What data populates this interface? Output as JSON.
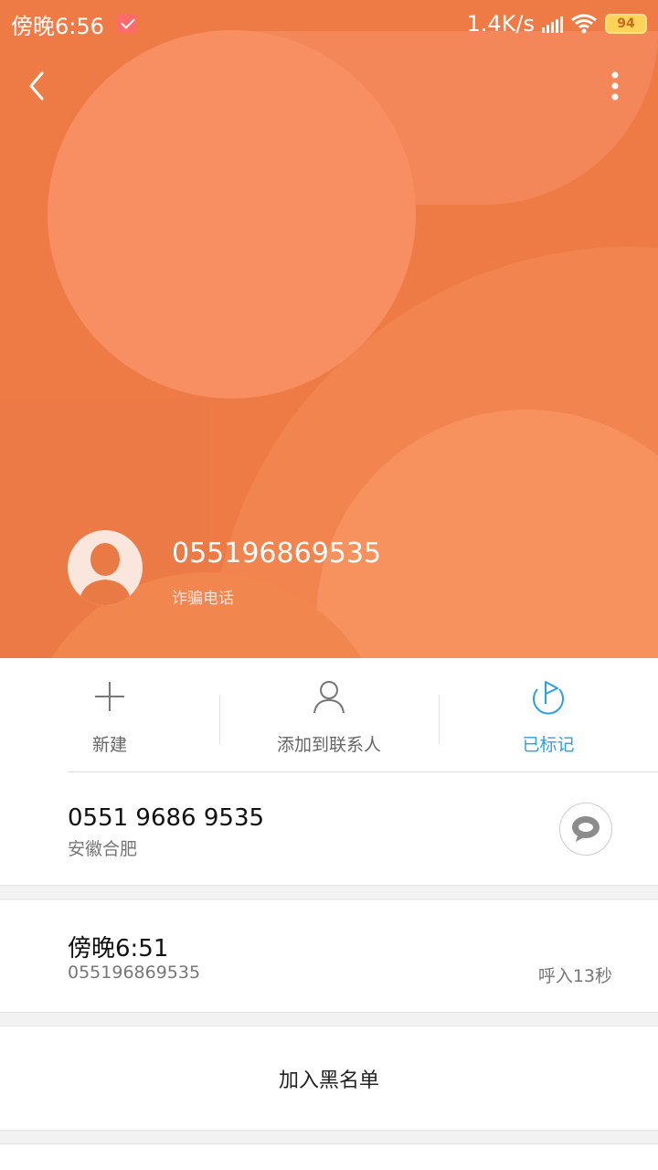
{
  "status_bar": {
    "time": "傍晚6:56",
    "network_speed": "1.4K/s",
    "battery": "94"
  },
  "header": {
    "caller_number": "055196869535",
    "caller_tag": "诈骗电话"
  },
  "actions": {
    "new_label": "新建",
    "add_contact_label": "添加到联系人",
    "marked_label": "已标记"
  },
  "phone_info": {
    "number": "0551 9686 9535",
    "location": "安徽合肥"
  },
  "call_log": {
    "time": "傍晚6:51",
    "number": "055196869535",
    "detail": "呼入13秒"
  },
  "blacklist": {
    "label": "加入黑名单"
  },
  "colors": {
    "header_orange": "#ee7b45",
    "accent_blue": "#2aa0e8"
  }
}
